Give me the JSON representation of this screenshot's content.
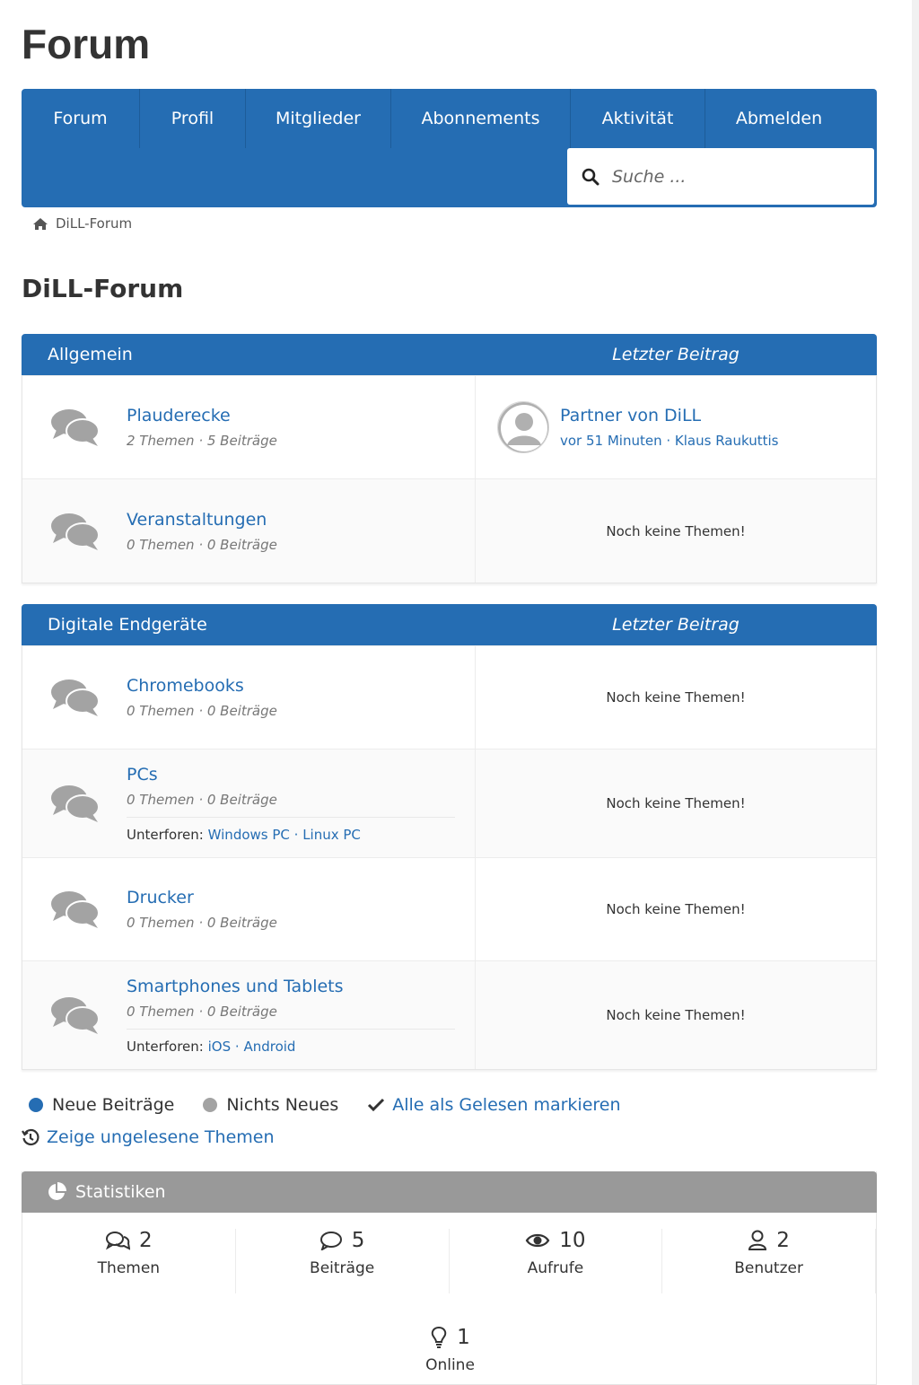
{
  "page": {
    "title": "Forum"
  },
  "nav": {
    "items": [
      "Forum",
      "Profil",
      "Mitglieder",
      "Abonnements",
      "Aktivität",
      "Abmelden"
    ],
    "search_placeholder": "Suche ..."
  },
  "breadcrumb": {
    "home": "DiLL-Forum"
  },
  "main": {
    "title": "DiLL-Forum"
  },
  "categories": [
    {
      "name": "Allgemein",
      "last_header": "Letzter Beitrag",
      "forums": [
        {
          "name": "Plauderecke",
          "meta": "2 Themen · 5 Beiträge",
          "last_title": "Partner von DiLL",
          "last_time": "vor 51 Minuten",
          "last_sep": " · ",
          "last_author": "Klaus Raukuttis"
        },
        {
          "name": "Veranstaltungen",
          "meta": "0 Themen · 0 Beiträge",
          "last_text": "Noch keine Themen!"
        }
      ]
    },
    {
      "name": "Digitale Endgeräte",
      "last_header": "Letzter Beitrag",
      "forums": [
        {
          "name": "Chromebooks",
          "meta": "0 Themen · 0 Beiträge",
          "last_text": "Noch keine Themen!"
        },
        {
          "name": "PCs",
          "meta": "0 Themen · 0 Beiträge",
          "sub_label": "Unterforen:",
          "sub1": "Windows PC",
          "sub_sep": " · ",
          "sub2": "Linux PC",
          "last_text": "Noch keine Themen!"
        },
        {
          "name": "Drucker",
          "meta": "0 Themen · 0 Beiträge",
          "last_text": "Noch keine Themen!"
        },
        {
          "name": "Smartphones und Tablets",
          "meta": "0 Themen · 0 Beiträge",
          "sub_label": "Unterforen:",
          "sub1": "iOS",
          "sub_sep": " · ",
          "sub2": "Android",
          "last_text": "Noch keine Themen!"
        }
      ]
    }
  ],
  "legend": {
    "new": "Neue Beiträge",
    "none": "Nichts Neues",
    "mark_read": "Alle als Gelesen markieren",
    "show_unread": "Zeige ungelesene Themen",
    "new_color": "#256db3",
    "none_color": "#a3a3a3"
  },
  "stats": {
    "title": "Statistiken",
    "items": [
      {
        "value": "2",
        "label": "Themen"
      },
      {
        "value": "5",
        "label": "Beiträge"
      },
      {
        "value": "10",
        "label": "Aufrufe"
      },
      {
        "value": "2",
        "label": "Benutzer"
      }
    ],
    "online": {
      "value": "1",
      "label": "Online"
    }
  },
  "colors": {
    "accent": "#256db3",
    "stats_header": "#999999"
  }
}
